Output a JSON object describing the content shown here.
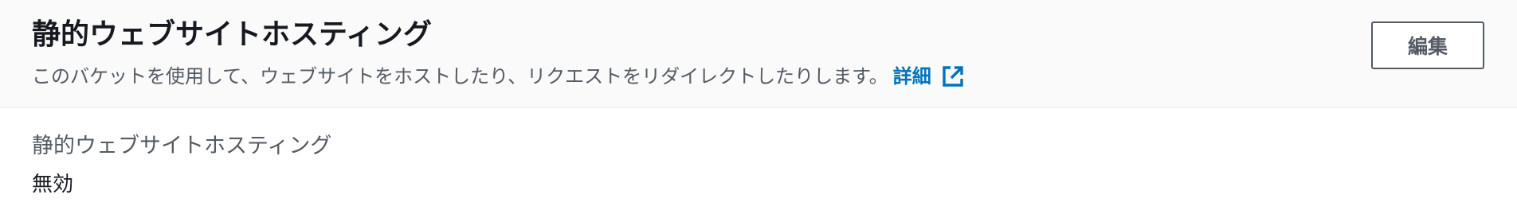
{
  "header": {
    "title": "静的ウェブサイトホスティング",
    "description": "このバケットを使用して、ウェブサイトをホストしたり、リクエストをリダイレクトしたりします。",
    "info_link_label": "詳細",
    "external_icon": "external-link-icon",
    "edit_label": "編集"
  },
  "body": {
    "field_label": "静的ウェブサイトホスティング",
    "field_value": "無効"
  },
  "colors": {
    "link": "#0073bb",
    "title": "#16191f",
    "secondary_text": "#545b64",
    "header_bg": "#fafafa"
  }
}
